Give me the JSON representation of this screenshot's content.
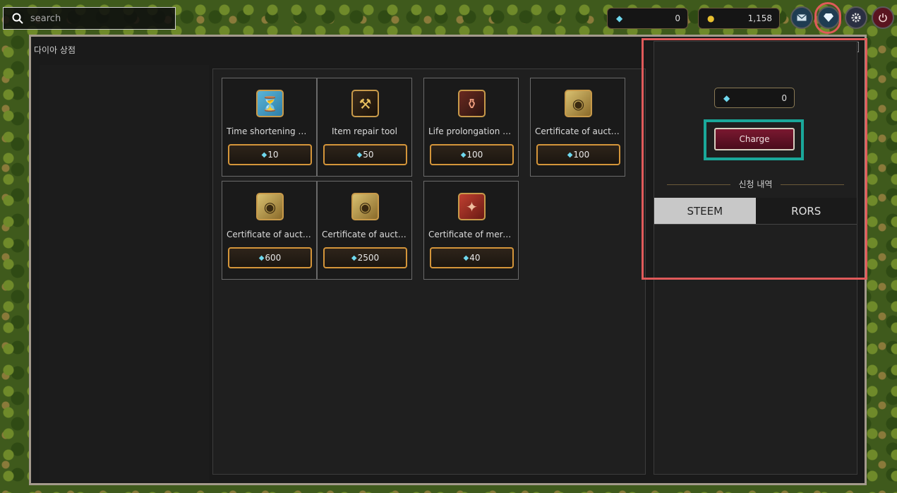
{
  "search": {
    "placeholder": "search"
  },
  "topbar": {
    "diamond_balance": "0",
    "gold_balance": "1,158",
    "buttons": [
      "mail-icon",
      "diamond-icon",
      "gear-icon",
      "power-icon"
    ]
  },
  "window": {
    "title": "다이아 상점",
    "close_label": "×"
  },
  "items": [
    {
      "name": "Time shortening m…",
      "price": "10",
      "icon": "time-scroll-icon"
    },
    {
      "name": "Item repair tool",
      "price": "50",
      "icon": "repair-tool-icon"
    },
    {
      "name": "Life prolongation p…",
      "price": "100",
      "icon": "potion-icon"
    },
    {
      "name": "Certificate of auctio…",
      "price": "100",
      "icon": "certificate-icon"
    },
    {
      "name": "Certificate of auctio…",
      "price": "600",
      "icon": "certificate-icon"
    },
    {
      "name": "Certificate of auctio…",
      "price": "2500",
      "icon": "certificate-icon"
    },
    {
      "name": "Certificate of merce…",
      "price": "40",
      "icon": "mercenary-book-icon"
    }
  ],
  "side": {
    "balance": "0",
    "charge_label": "Charge",
    "history_title": "신청 내역",
    "tabs": [
      {
        "label": "STEEM",
        "active": true
      },
      {
        "label": "RORS",
        "active": false
      }
    ]
  },
  "colors": {
    "highlight_red": "#e05a5a",
    "highlight_teal": "#1aa89a",
    "price_border": "#d4953a",
    "charge_bg": "#7a1830"
  }
}
